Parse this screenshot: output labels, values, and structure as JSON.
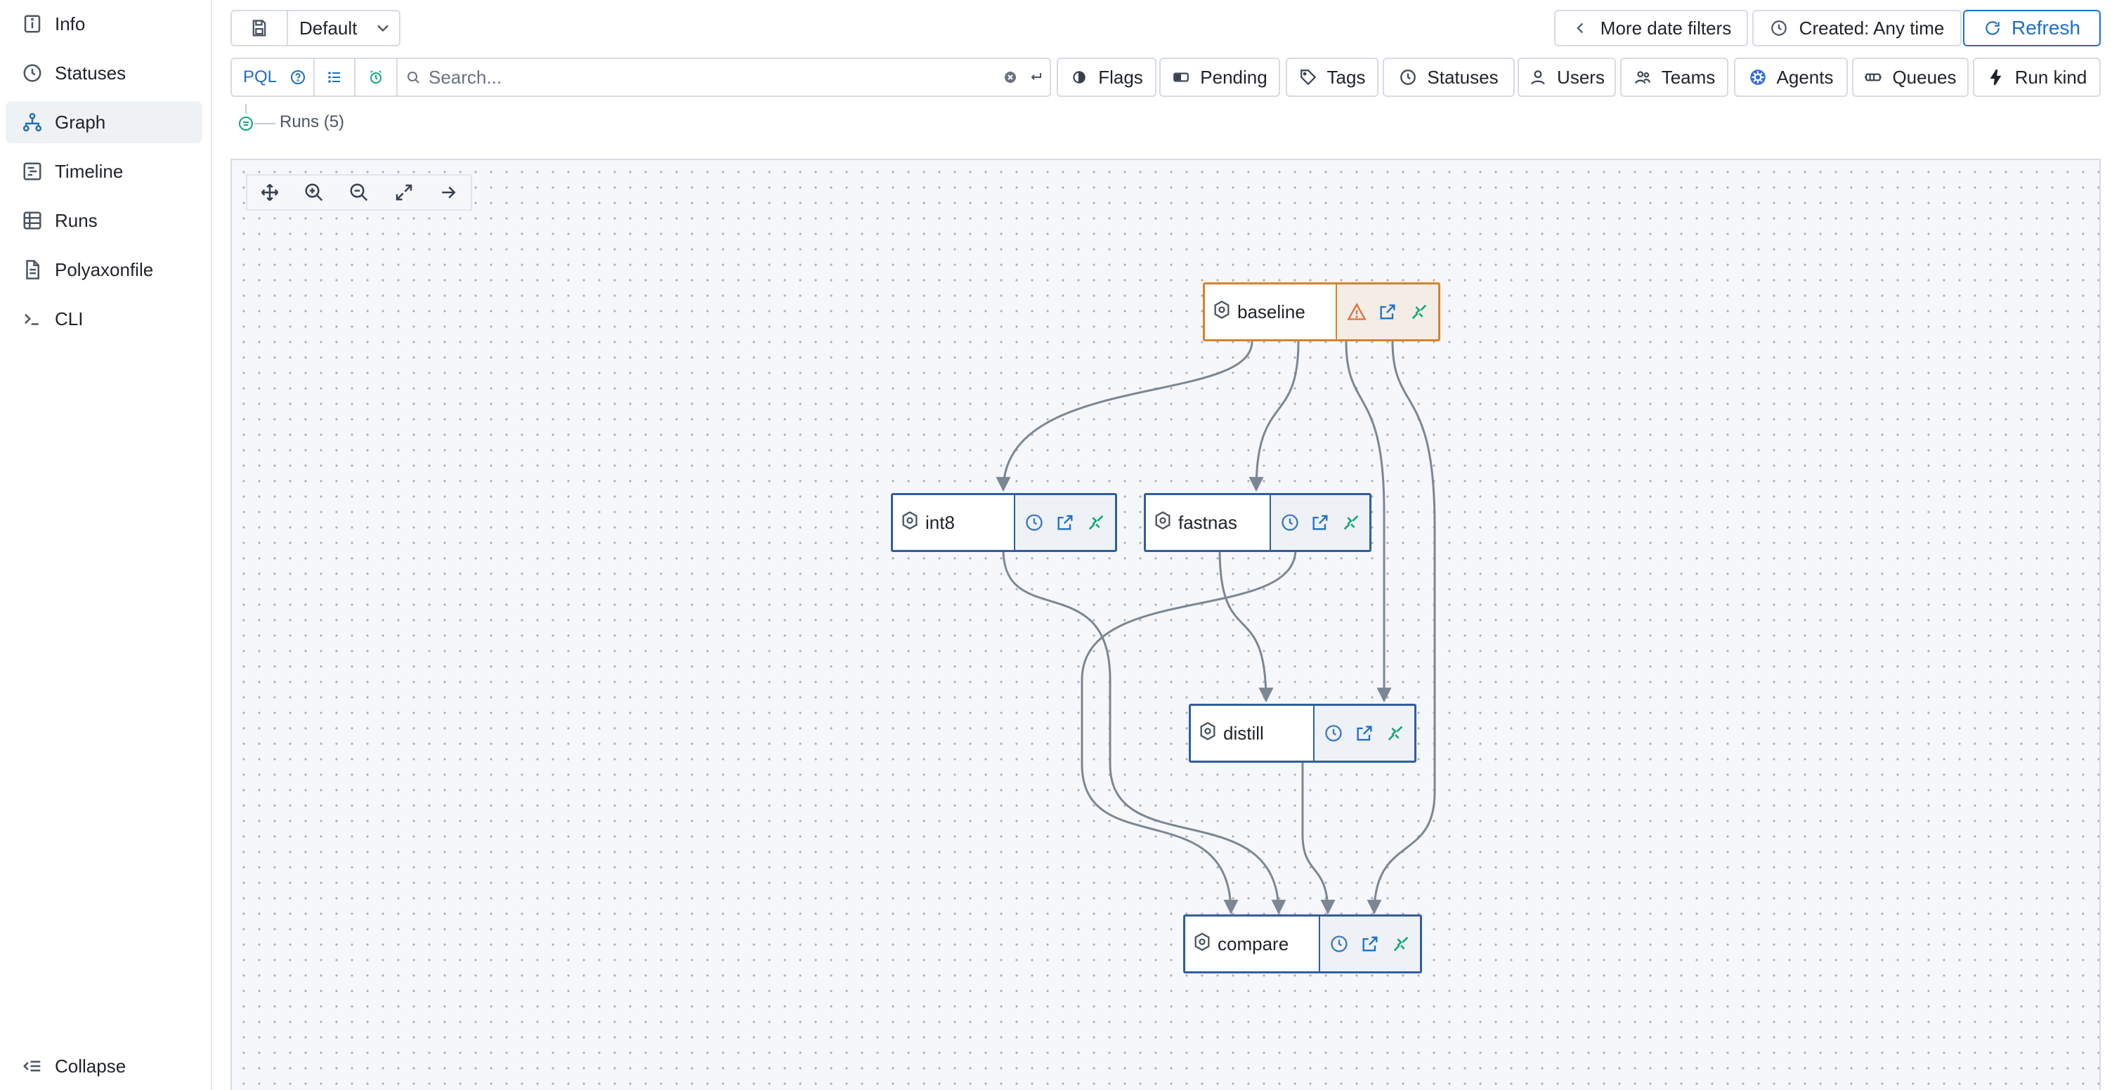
{
  "sidebar": {
    "items": [
      {
        "label": "Info",
        "icon": "info-icon"
      },
      {
        "label": "Statuses",
        "icon": "clock-icon"
      },
      {
        "label": "Graph",
        "icon": "graph-icon",
        "active": true
      },
      {
        "label": "Timeline",
        "icon": "timeline-icon"
      },
      {
        "label": "Runs",
        "icon": "list-icon"
      },
      {
        "label": "Polyaxonfile",
        "icon": "file-icon"
      },
      {
        "label": "CLI",
        "icon": "terminal-icon"
      }
    ],
    "collapse_label": "Collapse"
  },
  "toolbar": {
    "view_name": "Default",
    "more_date_filters": "More date filters",
    "created_filter": "Created: Any time",
    "refresh_label": "Refresh"
  },
  "filters": {
    "pql_label": "PQL",
    "search_placeholder": "Search...",
    "buttons": [
      "Flags",
      "Pending",
      "Tags",
      "Statuses",
      "Users",
      "Teams",
      "Agents",
      "Queues",
      "Run kind"
    ]
  },
  "runs_count": "Runs (5)",
  "graph": {
    "nodes": [
      {
        "id": "baseline",
        "label": "baseline",
        "status": "warning"
      },
      {
        "id": "int8",
        "label": "int8",
        "status": "scheduled"
      },
      {
        "id": "fastnas",
        "label": "fastnas",
        "status": "scheduled"
      },
      {
        "id": "distill",
        "label": "distill",
        "status": "scheduled"
      },
      {
        "id": "compare",
        "label": "compare",
        "status": "scheduled"
      }
    ],
    "edges": [
      [
        "baseline",
        "int8"
      ],
      [
        "baseline",
        "fastnas"
      ],
      [
        "baseline",
        "distill"
      ],
      [
        "baseline",
        "compare"
      ],
      [
        "int8",
        "compare"
      ],
      [
        "fastnas",
        "distill"
      ],
      [
        "fastnas",
        "compare"
      ],
      [
        "distill",
        "compare"
      ]
    ]
  },
  "colors": {
    "accent": "#1f6fc5",
    "node_border": "#2f5e9f",
    "warning_border": "#d9822b",
    "edge": "#7b8794",
    "canvas_bg": "#f6f7fa"
  }
}
